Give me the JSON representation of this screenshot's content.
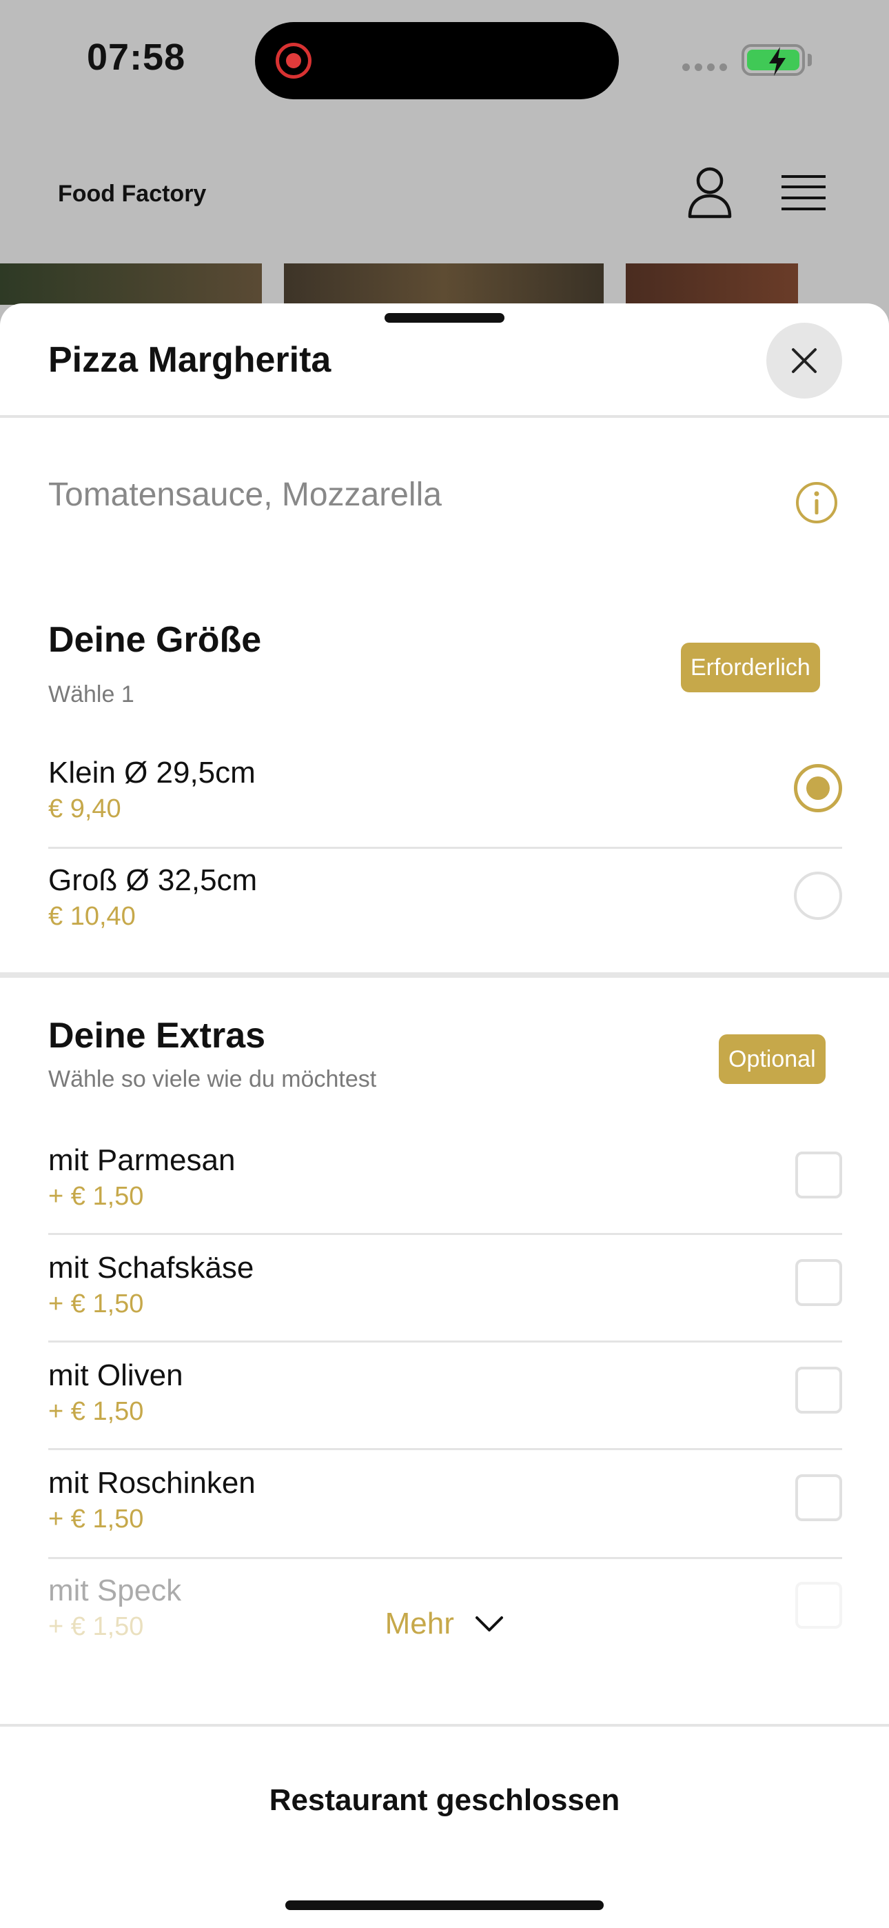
{
  "status_bar": {
    "time": "07:58"
  },
  "header": {
    "brand": "Food Factory"
  },
  "sheet": {
    "title": "Pizza Margherita",
    "description": "Tomatensauce, Mozzarella"
  },
  "size_section": {
    "title": "Deine Größe",
    "subtitle": "Wähle 1",
    "badge": "Erforderlich",
    "options": [
      {
        "name": "Klein Ø 29,5cm",
        "price": "€ 9,40",
        "selected": true
      },
      {
        "name": "Groß Ø 32,5cm",
        "price": "€ 10,40",
        "selected": false
      }
    ]
  },
  "extras_section": {
    "title": "Deine Extras",
    "subtitle": "Wähle so viele wie du möchtest",
    "badge": "Optional",
    "options": [
      {
        "name": "mit Parmesan",
        "price": "+ € 1,50"
      },
      {
        "name": "mit Schafskäse",
        "price": "+ € 1,50"
      },
      {
        "name": "mit Oliven",
        "price": "+ € 1,50"
      },
      {
        "name": "mit Roschinken",
        "price": "+ € 1,50"
      },
      {
        "name": "mit Speck",
        "price": "+ € 1,50"
      }
    ]
  },
  "more": {
    "label": "Mehr"
  },
  "footer": {
    "status": "Restaurant geschlossen"
  },
  "colors": {
    "accent": "#c6a84a",
    "battery": "#40c956",
    "record": "#e23b3b"
  }
}
